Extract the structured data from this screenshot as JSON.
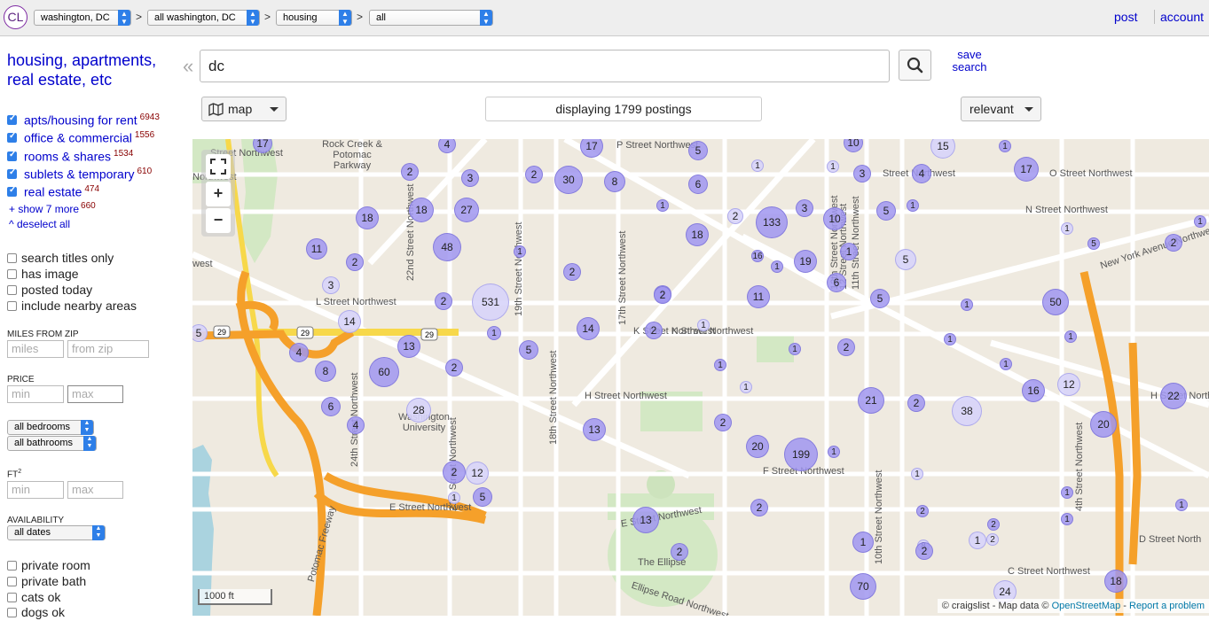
{
  "header": {
    "logo": "CL",
    "breadcrumbs": [
      "washington, DC",
      "all washington, DC",
      "housing",
      "all"
    ],
    "separator": ">",
    "post_label": "post",
    "account_label": "account"
  },
  "sidebar": {
    "category_title": "housing, apartments, real estate, etc",
    "categories": [
      {
        "label": "apts/housing for rent",
        "count": "6943",
        "checked": true
      },
      {
        "label": "office & commercial",
        "count": "1556",
        "checked": true
      },
      {
        "label": "rooms & shares",
        "count": "1534",
        "checked": true
      },
      {
        "label": "sublets & temporary",
        "count": "610",
        "checked": true
      },
      {
        "label": "real estate",
        "count": "474",
        "checked": true
      }
    ],
    "show_more": {
      "label": "+ show 7 more",
      "count": "660"
    },
    "deselect_all": "^ deselect all",
    "options": [
      "search titles only",
      "has image",
      "posted today",
      "include nearby areas"
    ],
    "miles_from_zip": {
      "label": "MILES FROM ZIP",
      "miles_placeholder": "miles",
      "zip_placeholder": "from zip"
    },
    "price": {
      "label": "PRICE",
      "min_placeholder": "min",
      "max_placeholder": "max"
    },
    "bedrooms": "all bedrooms",
    "bathrooms": "all bathrooms",
    "sqft": {
      "label": "FT",
      "sup": "2",
      "min_placeholder": "min",
      "max_placeholder": "max"
    },
    "availability": {
      "label": "AVAILABILITY",
      "value": "all dates"
    },
    "extra_options": [
      "private room",
      "private bath",
      "cats ok",
      "dogs ok"
    ]
  },
  "search": {
    "query": "dc",
    "save_search": "save search",
    "collapse_icon": "«"
  },
  "toolbar": {
    "view_label": "map",
    "display_count": "displaying 1799 postings",
    "sort_label": "relevant"
  },
  "map": {
    "scale_label": "1000 ft",
    "attribution_prefix": "© craigslist - Map data ©",
    "attribution_osm": "OpenStreetMap",
    "attribution_sep": " - ",
    "attribution_report": "Report a problem",
    "street_labels": [
      "P Street Northwest",
      "O Street Northwest",
      "N Street Northwest",
      "L Street Northwest",
      "K Street Northwest",
      "H Street Northwest",
      "F Street Northwest",
      "E Street Northwest",
      "C Street Northwest",
      "D Street North",
      "New York Avenue Northwest",
      "Rock Creek & Potomac Parkway",
      "Washington University",
      "The Ellipse",
      "Ellipse Road Northwest",
      "Potomac Freeway",
      "22nd Street Northwest",
      "24th Street Northwest",
      "21st Street Northwest",
      "19th Street Northwest",
      "17th Street Northwest",
      "18th Street Northwest",
      "11th Street Northwest",
      "12th Street Northwest",
      "10th Street Northwest",
      "4th Street Northwest",
      "H Street Northwest",
      "K Street Northwest",
      "E Street Northwest",
      "Street Northwest",
      "Northwest",
      "west",
      "12 Street Northwest",
      "Street Northwest"
    ],
    "highway_shields": [
      "29",
      "29",
      "29"
    ],
    "clusters": [
      "17",
      "5",
      "10",
      "15",
      "17",
      "4",
      "1",
      "2",
      "30",
      "8",
      "6",
      "1",
      "1",
      "3",
      "4",
      "17",
      "2",
      "3",
      "18",
      "1",
      "2",
      "133",
      "3",
      "10",
      "5",
      "1",
      "1",
      "2",
      "18",
      "27",
      "18",
      "16",
      "1",
      "5",
      "1",
      "5",
      "2",
      "11",
      "48",
      "1",
      "19",
      "2",
      "2",
      "1",
      "6",
      "3",
      "2",
      "531",
      "2",
      "11",
      "5",
      "50",
      "1",
      "14",
      "14",
      "5",
      "1",
      "2",
      "1",
      "1",
      "1",
      "13",
      "5",
      "1",
      "2",
      "1",
      "4",
      "8",
      "60",
      "2",
      "1",
      "1",
      "2",
      "21",
      "2",
      "38",
      "16",
      "12",
      "22",
      "6",
      "28",
      "13",
      "2",
      "20",
      "199",
      "1",
      "20",
      "4",
      "12",
      "1",
      "1",
      "5",
      "13",
      "2",
      "2",
      "2",
      "1",
      "8",
      "1",
      "2",
      "1",
      "2",
      "70",
      "24",
      "1",
      "18",
      "1",
      "1",
      "2"
    ]
  },
  "colors": {
    "accent": "#2e7fe8",
    "link": "#0000cc",
    "cluster": "#a096f0",
    "highway": "#f5a02a"
  }
}
